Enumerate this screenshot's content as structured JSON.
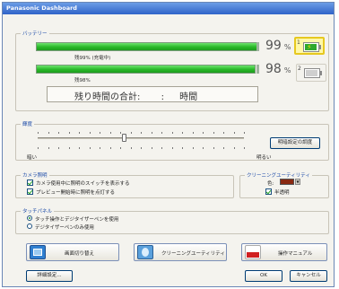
{
  "window": {
    "title": "Panasonic Dashboard"
  },
  "battery": {
    "group_label": "バッテリー",
    "bars": [
      {
        "label": "残99% (充電中)",
        "level": 0.99,
        "percent": "99",
        "sign": "%",
        "icon": "battery-charging-icon",
        "icon_number": "1",
        "active": true
      },
      {
        "label": "残98%",
        "level": 0.98,
        "percent": "98",
        "sign": "%",
        "icon": "battery-icon",
        "icon_number": "2",
        "active": false
      }
    ],
    "total_label": "残り時間の合計:",
    "total_sep": ":",
    "total_unit": "時間"
  },
  "brightness": {
    "group_label": "輝度",
    "low_label": "暗い",
    "high_label": "明るい",
    "level": 0.42,
    "settings_button": "明暗設定の調度"
  },
  "camera": {
    "group_label": "カメラ照明",
    "checks": [
      {
        "label": "カメラ使用中に照明のスイッチを表示する",
        "checked": true
      },
      {
        "label": "プレビュー開始時に照明を点灯する",
        "checked": true
      }
    ]
  },
  "cleaning": {
    "group_label": "クリーニングユーティリティ",
    "color_label": "色:",
    "color_value": "#8a2a12",
    "translucent_label": "半透明",
    "translucent_checked": true
  },
  "touch": {
    "group_label": "タッチパネル",
    "options": [
      {
        "label": "タッチ操作とデジタイザーペンを使用",
        "selected": true
      },
      {
        "label": "デジタイザーペンのみ使用",
        "selected": false
      }
    ]
  },
  "actions": {
    "screen_switch": "画面切り替え",
    "cleaning_utility": "クリーニングユーティリティ",
    "manual": "操作マニュアル"
  },
  "footer": {
    "details_button": "詳細設定...",
    "ok_button": "OK",
    "cancel_button": "キャンセル"
  },
  "colors": {
    "bar_green": "#28b828",
    "titlebar_blue": "#2f63c8",
    "accent_label": "#1b4aa8"
  }
}
